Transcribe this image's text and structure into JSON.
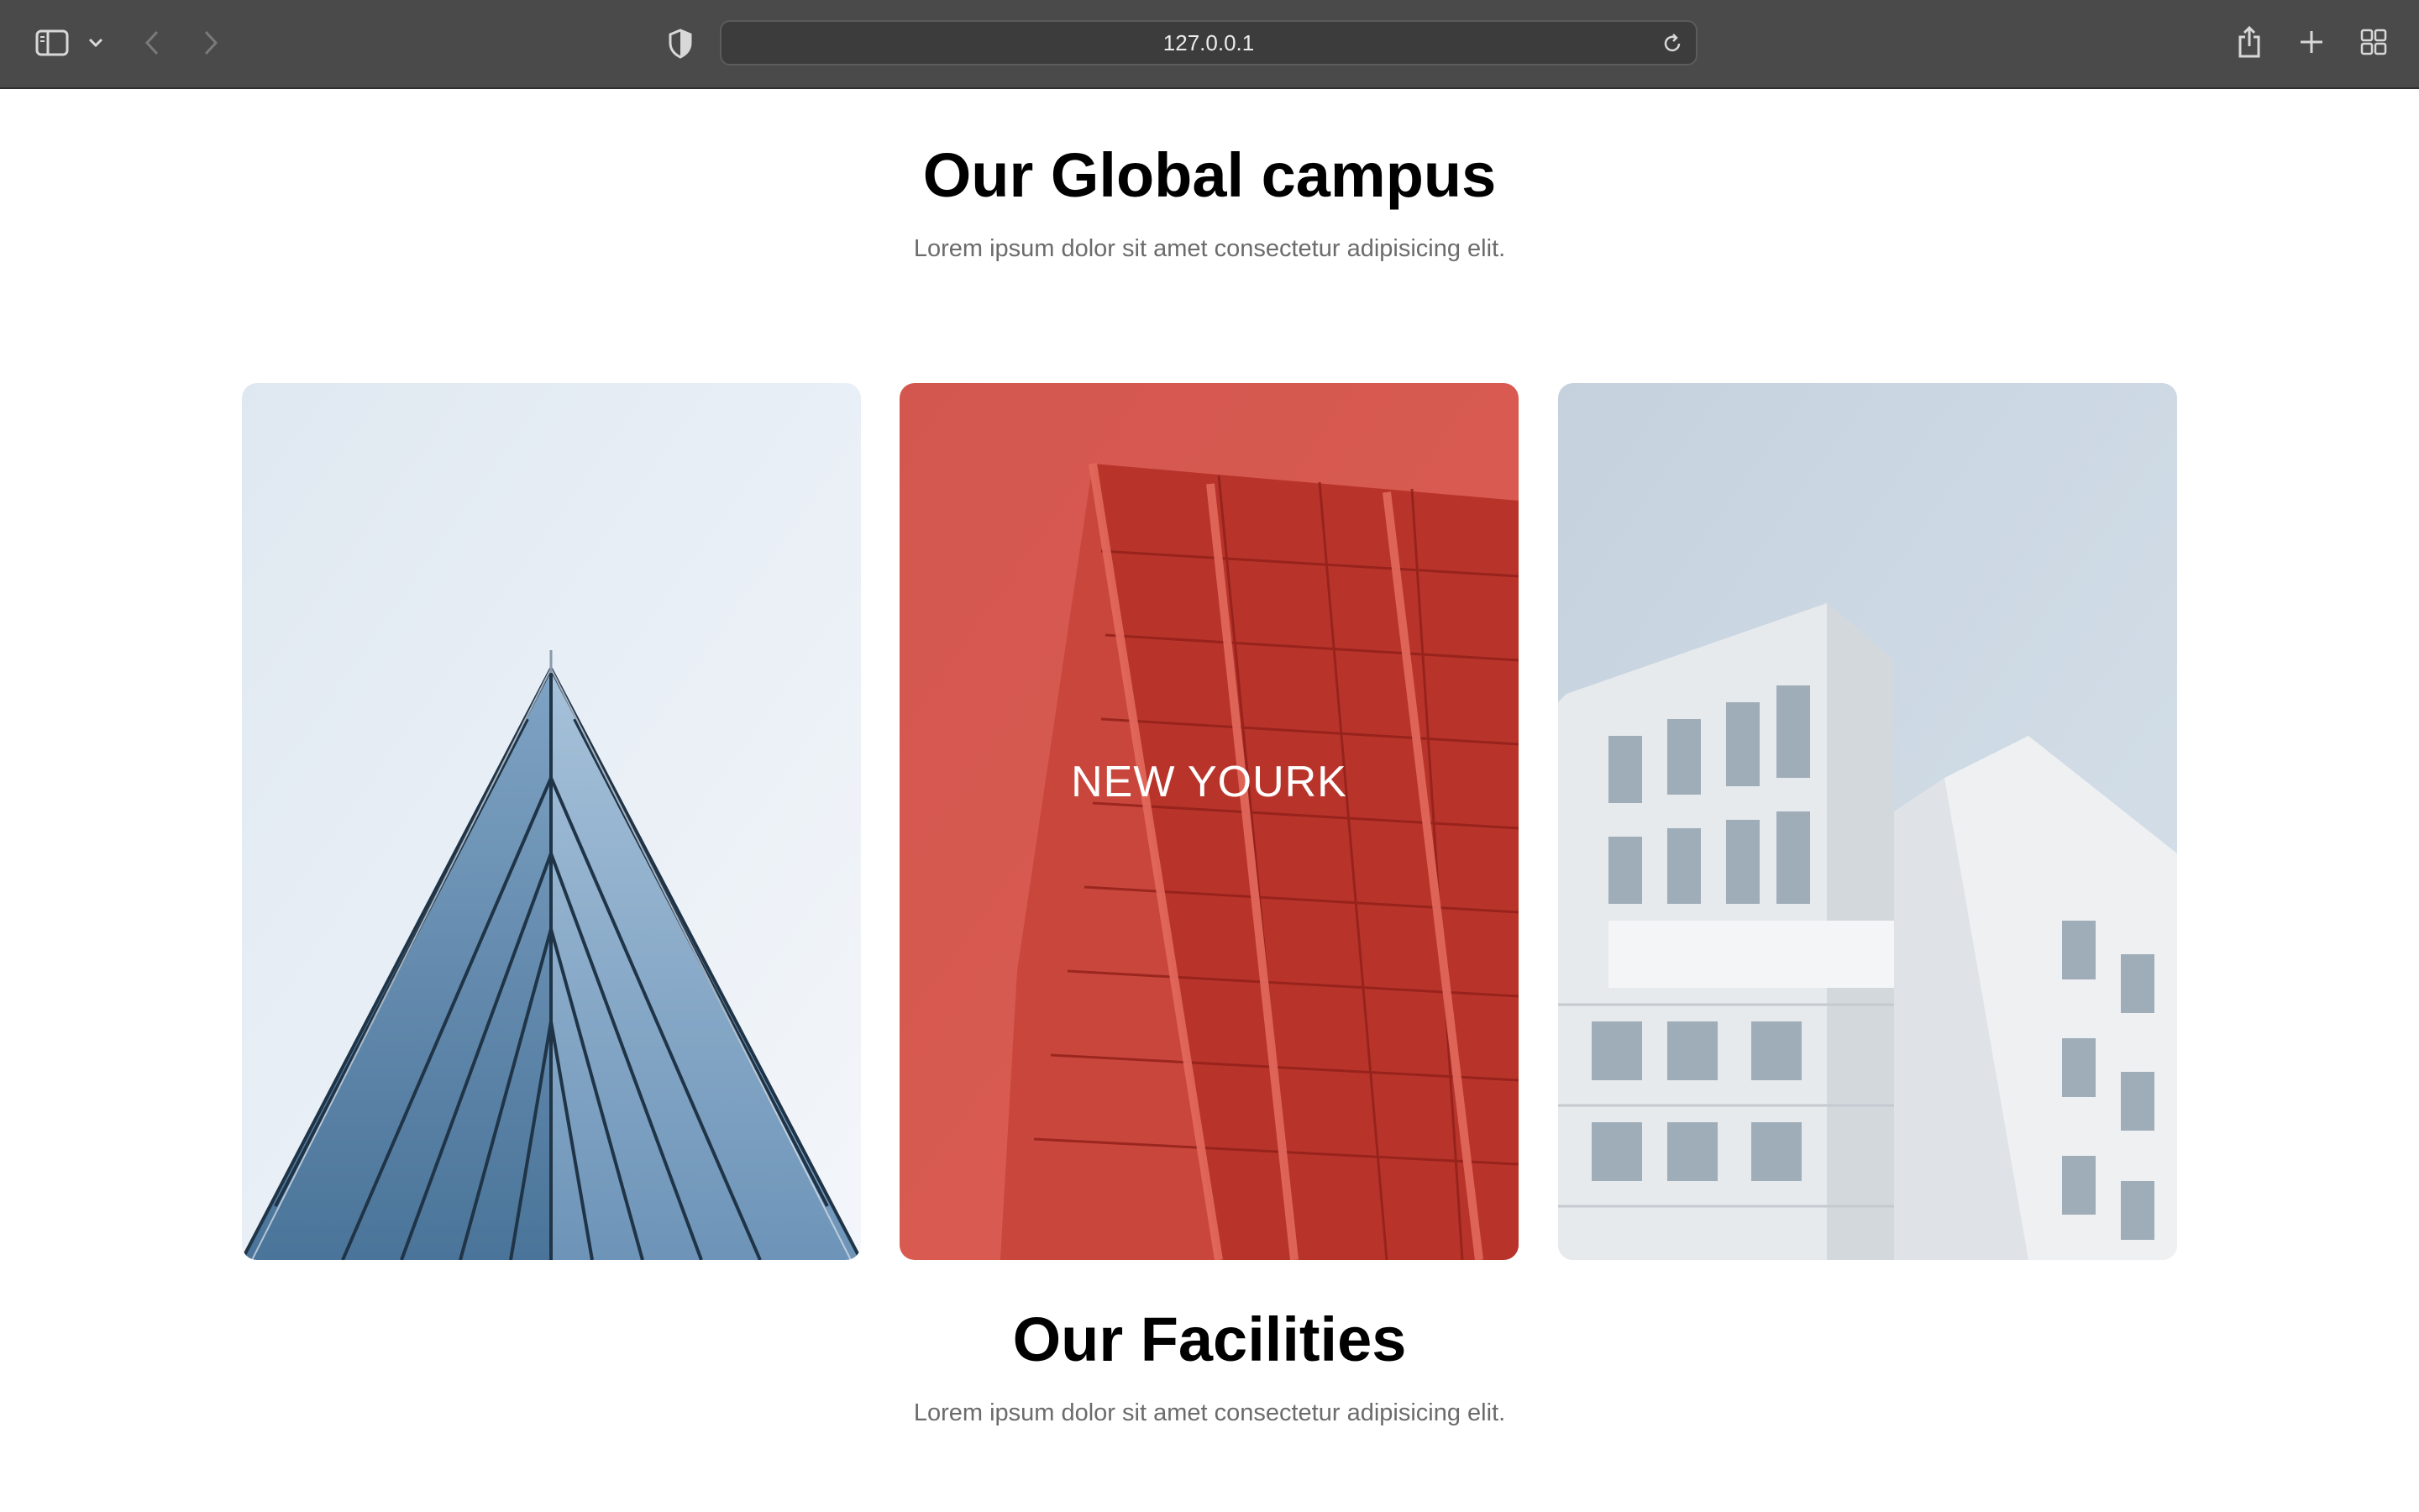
{
  "browser": {
    "url": "127.0.0.1",
    "icons": [
      "sidebar-icon",
      "chevron-down-icon",
      "back-arrow-icon",
      "forward-arrow-icon",
      "shield-icon",
      "reload-icon",
      "share-icon",
      "plus-icon",
      "tab-overview-icon"
    ]
  },
  "campus": {
    "title": "Our Global campus",
    "subtitle": "Lorem ipsum dolor sit amet consectetur adipisicing elit.",
    "cards": [
      {
        "caption": "",
        "overlay": null
      },
      {
        "caption": "NEW YOURK",
        "overlay": "#d9382c"
      },
      {
        "caption": "",
        "overlay": null
      }
    ]
  },
  "facilities": {
    "title": "Our Facilities",
    "subtitle": "Lorem ipsum dolor sit amet consectetur adipisicing elit."
  }
}
